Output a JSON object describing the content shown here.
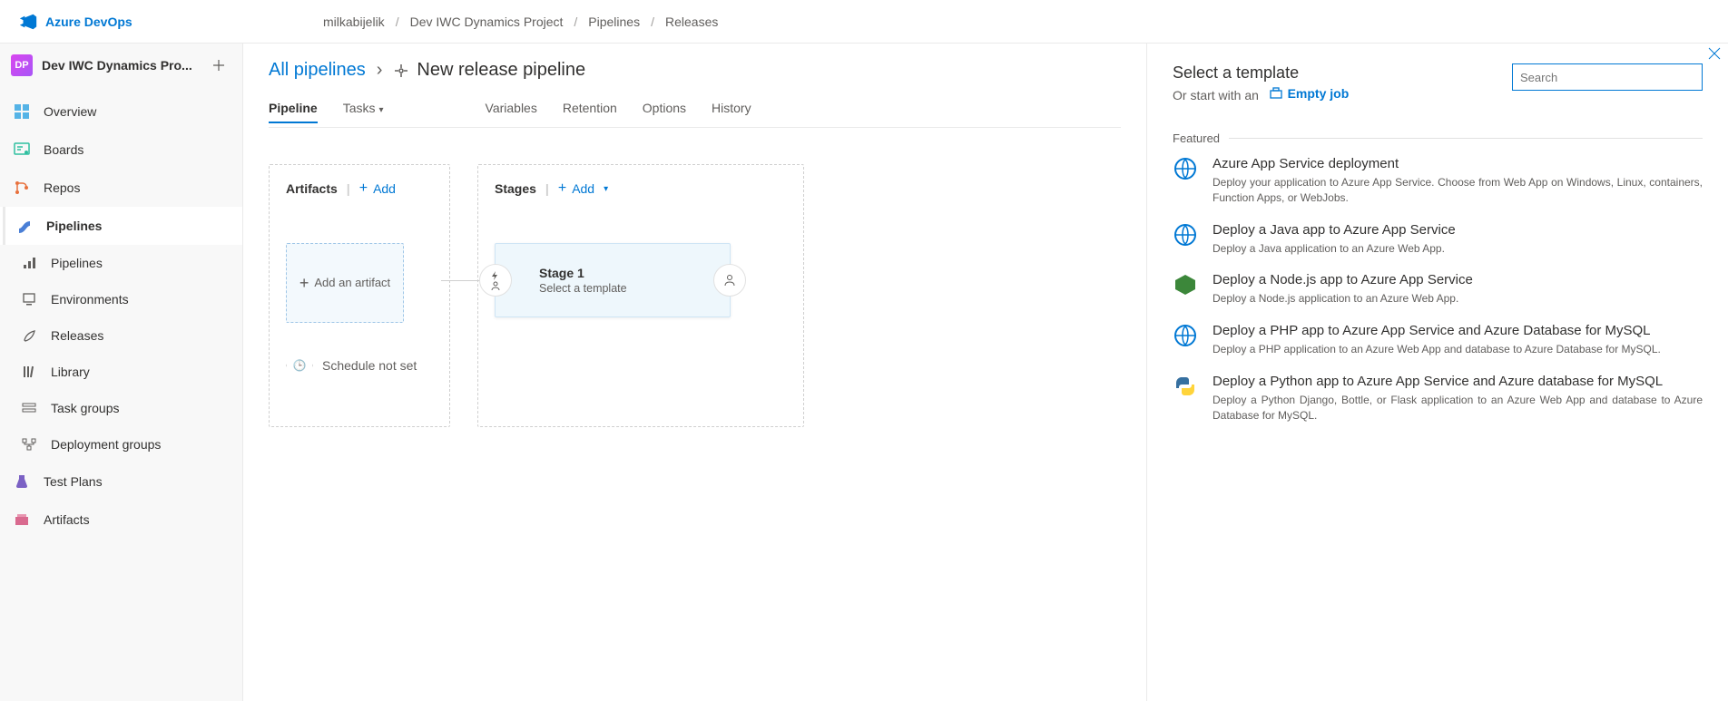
{
  "header": {
    "product": "Azure DevOps",
    "breadcrumbs": [
      "milkabijelik",
      "Dev IWC Dynamics Project",
      "Pipelines",
      "Releases"
    ]
  },
  "sidebar": {
    "project_badge": "DP",
    "project_name": "Dev IWC Dynamics Pro...",
    "items": [
      {
        "label": "Overview"
      },
      {
        "label": "Boards"
      },
      {
        "label": "Repos"
      },
      {
        "label": "Pipelines",
        "active": true
      },
      {
        "label": "Test Plans"
      },
      {
        "label": "Artifacts"
      }
    ],
    "pipeline_subitems": [
      {
        "label": "Pipelines"
      },
      {
        "label": "Environments"
      },
      {
        "label": "Releases"
      },
      {
        "label": "Library"
      },
      {
        "label": "Task groups"
      },
      {
        "label": "Deployment groups"
      }
    ]
  },
  "page": {
    "all_pipelines": "All pipelines",
    "title": "New release pipeline",
    "tabs": [
      "Pipeline",
      "Tasks",
      "Variables",
      "Retention",
      "Options",
      "History"
    ],
    "active_tab": "Pipeline",
    "artifacts": {
      "header": "Artifacts",
      "add_label": "Add",
      "add_artifact": "Add an artifact",
      "schedule": "Schedule not set"
    },
    "stages": {
      "header": "Stages",
      "add_label": "Add",
      "stage_title": "Stage 1",
      "stage_sub": "Select a template"
    }
  },
  "panel": {
    "title": "Select a template",
    "or_start": "Or start with an",
    "empty_job": "Empty job",
    "search_placeholder": "Search",
    "section": "Featured",
    "templates": [
      {
        "title": "Azure App Service deployment",
        "desc": "Deploy your application to Azure App Service. Choose from Web App on Windows, Linux, containers, Function Apps, or WebJobs."
      },
      {
        "title": "Deploy a Java app to Azure App Service",
        "desc": "Deploy a Java application to an Azure Web App."
      },
      {
        "title": "Deploy a Node.js app to Azure App Service",
        "desc": "Deploy a Node.js application to an Azure Web App."
      },
      {
        "title": "Deploy a PHP app to Azure App Service and Azure Database for MySQL",
        "desc": "Deploy a PHP application to an Azure Web App and database to Azure Database for MySQL."
      },
      {
        "title": "Deploy a Python app to Azure App Service and Azure database for MySQL",
        "desc": "Deploy a Python Django, Bottle, or Flask application to an Azure Web App and database to Azure Database for MySQL."
      }
    ]
  }
}
